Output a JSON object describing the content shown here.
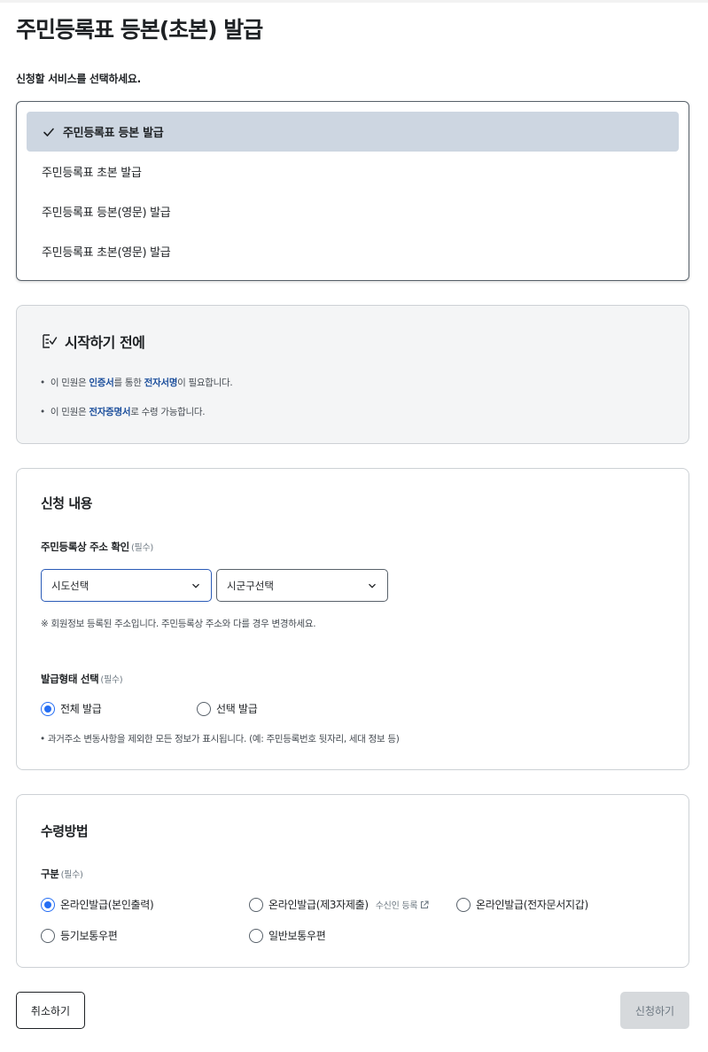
{
  "page": {
    "title": "주민등록표 등본(초본) 발급",
    "service_prompt": "신청할 서비스를 선택하세요."
  },
  "services": {
    "selected_index": 0,
    "options": [
      "주민등록표 등본 발급",
      "주민등록표 초본 발급",
      "주민등록표 등본(영문) 발급",
      "주민등록표 초본(영문) 발급"
    ]
  },
  "before_start": {
    "title": "시작하기 전에",
    "note1": {
      "bullet": "•",
      "pre": "이 민원은 ",
      "em1": "인증서",
      "mid": "를 통한 ",
      "em2": "전자서명",
      "post": "이 필요합니다."
    },
    "note2": {
      "bullet": "•",
      "pre": "이 민원은 ",
      "em1": "전자증명서",
      "post": "로 수령 가능합니다."
    }
  },
  "application": {
    "title": "신청 내용",
    "address_label": "주민등록상 주소 확인",
    "required": "(필수)",
    "sido_select": "시도선택",
    "sigungu_select": "시군구선택",
    "address_hint": "※ 회원정보 등록된 주소입니다. 주민등록상 주소와 다를 경우 변경하세요.",
    "issue_type_label": "발급형태 선택",
    "issue_options": [
      "전체 발급",
      "선택 발급"
    ],
    "issue_selected_index": 0,
    "issue_hint": "• 과거주소 변동사항을 제외한 모든 정보가 표시됩니다. (예: 주민등록번호 뒷자리, 세대 정보 등)"
  },
  "receive": {
    "title": "수령방법",
    "category_label": "구분",
    "required": "(필수)",
    "options": [
      "온라인발급(본인출력)",
      "온라인발급(제3자제출)",
      "온라인발급(전자문서지갑)",
      "등기보통우편",
      "일반보통우편"
    ],
    "selected_index": 0,
    "register_link": "수신인 등록"
  },
  "buttons": {
    "cancel": "취소하기",
    "submit": "신청하기"
  },
  "colors": {
    "accent": "#256ef4",
    "selected_bg": "#cdd6e1",
    "link_text": "#1c4f9c",
    "disabled_btn": "#d6d9dc"
  },
  "icons": {
    "check": "check-icon",
    "checklist": "checklist-icon",
    "chevron": "chevron-down-icon",
    "external": "external-link-icon"
  }
}
